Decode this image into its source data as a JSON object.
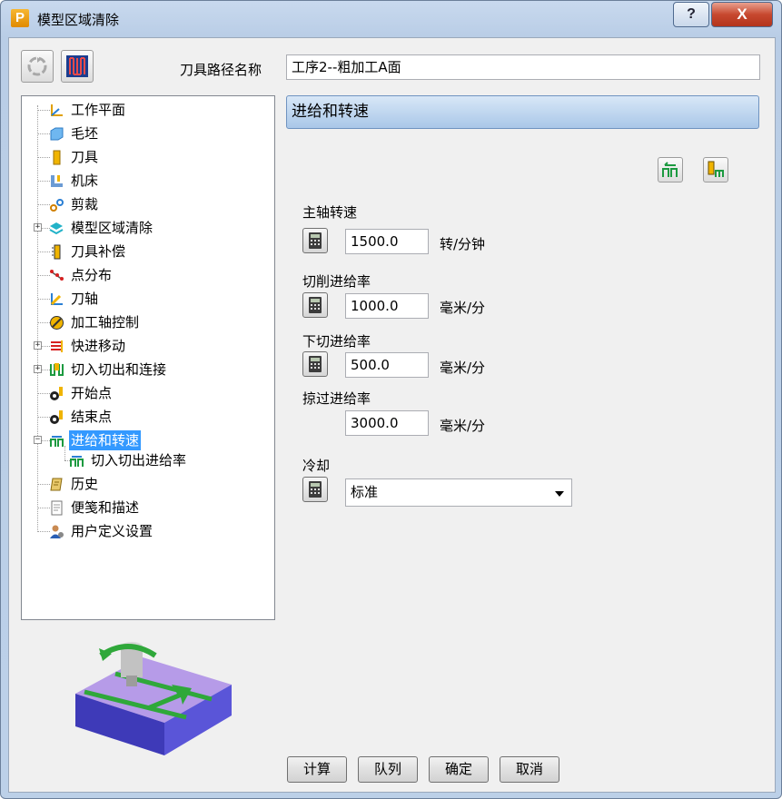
{
  "window": {
    "title": "模型区域清除",
    "help_label": "?",
    "close_label": "X"
  },
  "toolbar": {
    "path_name_label": "刀具路径名称",
    "path_name_value": "工序2--粗加工A面"
  },
  "tree": [
    {
      "label": "工作平面",
      "icon": "workplane-icon"
    },
    {
      "label": "毛坯",
      "icon": "block-icon"
    },
    {
      "label": "刀具",
      "icon": "tool-icon"
    },
    {
      "label": "机床",
      "icon": "machine-icon"
    },
    {
      "label": "剪裁",
      "icon": "trim-icon"
    },
    {
      "label": "模型区域清除",
      "icon": "area-clear-icon"
    },
    {
      "label": "刀具补偿",
      "icon": "tool-comp-icon"
    },
    {
      "label": "点分布",
      "icon": "point-dist-icon"
    },
    {
      "label": "刀轴",
      "icon": "tool-axis-icon"
    },
    {
      "label": "加工轴控制",
      "icon": "axis-control-icon"
    },
    {
      "label": "快进移动",
      "icon": "rapid-move-icon"
    },
    {
      "label": "切入切出和连接",
      "icon": "leads-links-icon"
    },
    {
      "label": "开始点",
      "icon": "start-point-icon"
    },
    {
      "label": "结束点",
      "icon": "end-point-icon"
    },
    {
      "label": "进给和转速",
      "icon": "feeds-speeds-icon"
    },
    {
      "label": "切入切出进给率",
      "icon": "lead-feed-icon"
    },
    {
      "label": "历史",
      "icon": "history-icon"
    },
    {
      "label": "便笺和描述",
      "icon": "notes-icon"
    },
    {
      "label": "用户定义设置",
      "icon": "user-settings-icon"
    }
  ],
  "panel": {
    "header": "进给和转速",
    "spindle": {
      "label": "主轴转速",
      "value": "1500.0",
      "unit": "转/分钟"
    },
    "cutting_feed": {
      "label": "切削进给率",
      "value": "1000.0",
      "unit": "毫米/分"
    },
    "plunge_feed": {
      "label": "下切进给率",
      "value": "500.0",
      "unit": "毫米/分"
    },
    "skim_feed": {
      "label": "掠过进给率",
      "value": "3000.0",
      "unit": "毫米/分"
    },
    "coolant": {
      "label": "冷却",
      "value": "标准"
    }
  },
  "buttons": {
    "calculate": "计算",
    "queue": "队列",
    "ok": "确定",
    "cancel": "取消"
  },
  "colors": {
    "selection": "#3399ff",
    "header_bg": "#b7d1ee",
    "window_frame": "#bcd0e8"
  }
}
